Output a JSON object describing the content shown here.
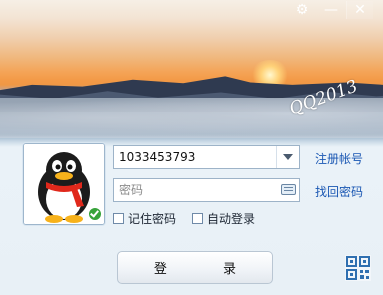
{
  "titlebar": {
    "settings_icon": "gear-icon",
    "minimize_icon": "minimize-icon",
    "close_icon": "close-icon",
    "minimize_glyph": "—",
    "close_glyph": "✕",
    "settings_glyph": "⚙"
  },
  "banner": {
    "signature_text": "QQ2013"
  },
  "login": {
    "account_value": "1033453793",
    "password_placeholder": "密码",
    "register_link": "注册帐号",
    "recover_link": "找回密码",
    "remember_label": "记住密码",
    "auto_login_label": "自动登录",
    "login_button": "登 录"
  },
  "avatar": {
    "status": "online"
  },
  "colors": {
    "link": "#1a57b3",
    "status_online": "#37a33a"
  }
}
